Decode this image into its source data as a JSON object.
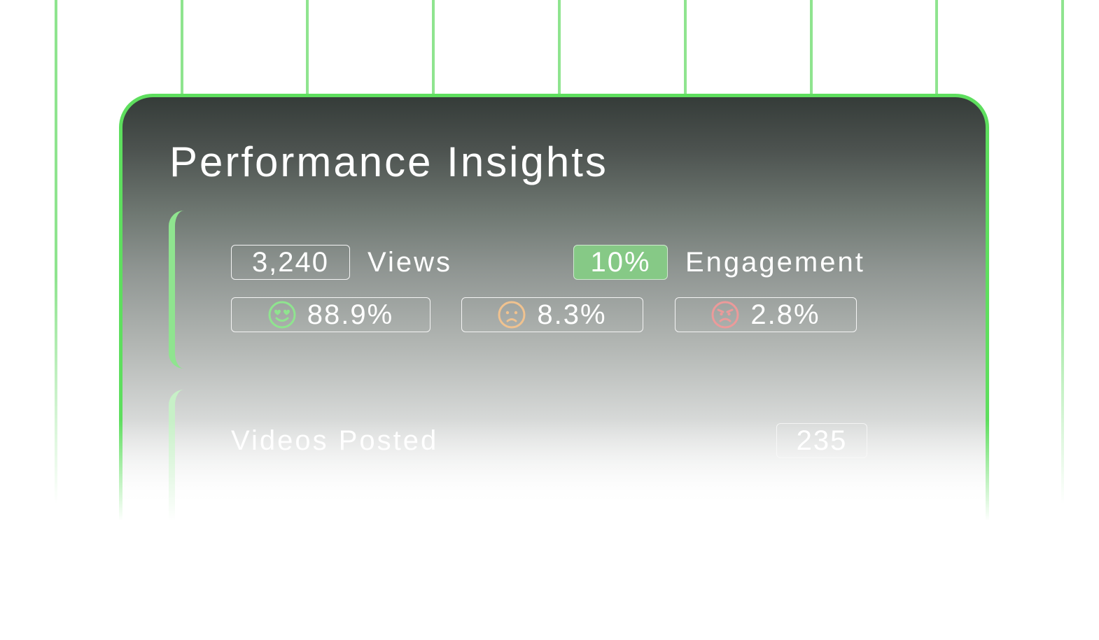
{
  "card": {
    "title": "Performance Insights"
  },
  "stats": {
    "views_value": "3,240",
    "views_label": "Views",
    "engagement_value": "10%",
    "engagement_label": "Engagement"
  },
  "sentiment": [
    {
      "icon": "heart-eyes-face-icon",
      "value": "88.9%",
      "color": "#8fe48f"
    },
    {
      "icon": "sad-face-icon",
      "value": "8.3%",
      "color": "#f0c28f"
    },
    {
      "icon": "angry-face-icon",
      "value": "2.8%",
      "color": "#ec9a9a"
    }
  ],
  "videos": {
    "label": "Videos Posted",
    "value": "235"
  },
  "colors": {
    "accent_green": "#5ede5e",
    "engagement_badge": "#86c986"
  }
}
